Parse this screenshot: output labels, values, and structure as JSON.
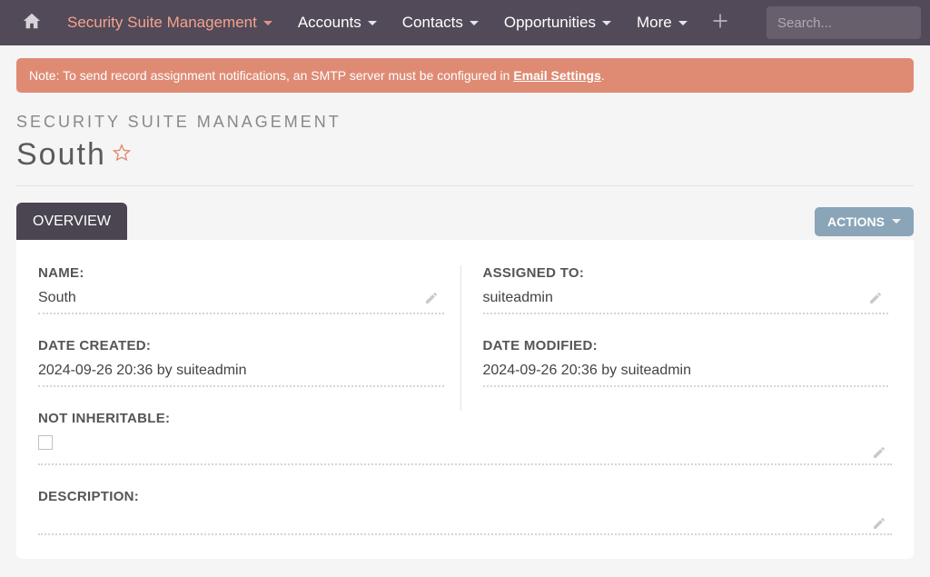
{
  "nav": {
    "active_module": "Security Suite Management",
    "items": [
      "Accounts",
      "Contacts",
      "Opportunities",
      "More"
    ],
    "search_placeholder": "Search..."
  },
  "alert": {
    "prefix": "Note: To send record assignment notifications, an SMTP server must be configured in ",
    "link_text": "Email Settings",
    "suffix": "."
  },
  "header": {
    "module_label": "SECURITY SUITE MANAGEMENT",
    "record_title": "South"
  },
  "tabs": {
    "overview": "OVERVIEW"
  },
  "actions": {
    "label": "ACTIONS"
  },
  "fields": {
    "name": {
      "label": "NAME:",
      "value": "South"
    },
    "assigned_to": {
      "label": "ASSIGNED TO:",
      "value": "suiteadmin"
    },
    "date_created": {
      "label": "DATE CREATED:",
      "value": "2024-09-26 20:36 by suiteadmin"
    },
    "date_modified": {
      "label": "DATE MODIFIED:",
      "value": "2024-09-26 20:36 by suiteadmin"
    },
    "not_inheritable": {
      "label": "NOT INHERITABLE:"
    },
    "description": {
      "label": "DESCRIPTION:",
      "value": ""
    }
  }
}
